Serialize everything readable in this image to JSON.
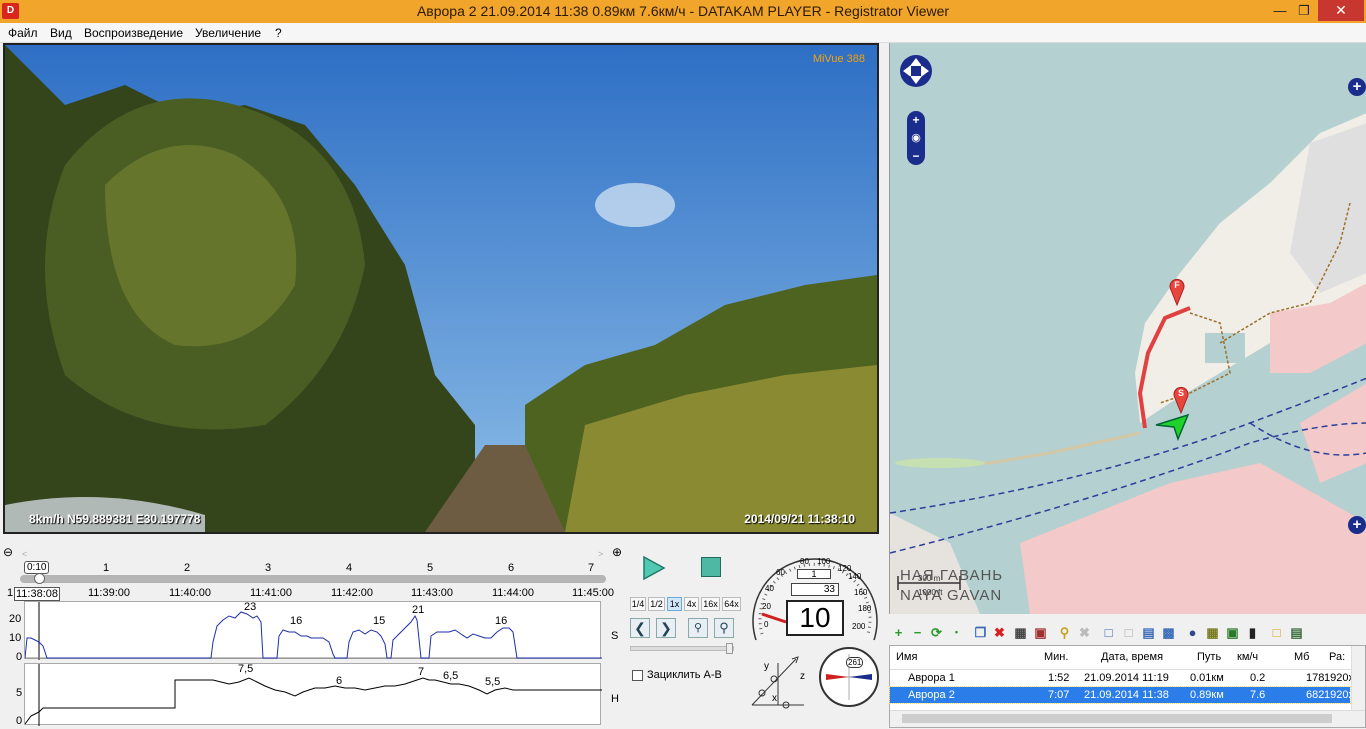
{
  "window": {
    "title": "Аврора 2    21.09.2014 11:38    0.89км    7.6км/ч  -  DATAKAM PLAYER - Registrator Viewer",
    "icon_text": "D"
  },
  "menu": [
    "Файл",
    "Вид",
    "Воспроизведение",
    "Увеличение",
    "?"
  ],
  "video": {
    "osd_left": "8km/h N59.889381 E30.197778",
    "osd_right": "2014/09/21 11:38:10",
    "logo": "MiVue 388"
  },
  "timeline": {
    "zoom_label": "0:10",
    "minute_marks": [
      "1",
      "2",
      "3",
      "4",
      "5",
      "6",
      "7"
    ],
    "current_time": "11:38:08",
    "start_prefix": "1",
    "times": [
      "11:39:00",
      "11:40:00",
      "11:41:00",
      "11:42:00",
      "11:43:00",
      "11:44:00",
      "11:45:00"
    ],
    "graph_s": {
      "label": "S",
      "ticks": [
        "20",
        "10",
        "0"
      ],
      "peaks": [
        "23",
        "16",
        "15",
        "21",
        "16"
      ]
    },
    "graph_h": {
      "label": "H",
      "ticks": [
        "5",
        "0"
      ],
      "peaks": [
        "7,5",
        "6",
        "7",
        "6,5",
        "5,5"
      ]
    }
  },
  "playback": {
    "speeds": [
      "1/4",
      "1/2",
      "1x",
      "4x",
      "16x",
      "64x"
    ],
    "active_speed": "1x",
    "loop_label": "Зациклить А-В"
  },
  "gauge": {
    "speed_value": "10",
    "odometer_top": "1",
    "odometer_bottom": "33",
    "scale": [
      "0",
      "20",
      "40",
      "60",
      "80",
      "100",
      "120",
      "140",
      "160",
      "180",
      "200"
    ],
    "compass_heading": "261",
    "axes": [
      "y",
      "z",
      "x"
    ]
  },
  "map": {
    "label_ru": "НАЯ ГАВАНЬ",
    "label_lat": "NAYA GAVAN",
    "scale_m": "300 m",
    "scale_ft": "1000 ft",
    "marker_finish": "F",
    "marker_start": "S"
  },
  "filelist": {
    "columns": [
      "Имя",
      "Мин.",
      "Дата, время",
      "Путь",
      "км/ч",
      "Мб",
      "Ра:"
    ],
    "rows": [
      {
        "name": "Аврора 1",
        "min": "1:52",
        "datetime": "21.09.2014 11:19",
        "path": "0.01км",
        "speed": "0.2",
        "mb": "178",
        "res": "1920x"
      },
      {
        "name": "Аврора 2",
        "min": "7:07",
        "datetime": "21.09.2014 11:38",
        "path": "0.89км",
        "speed": "7.6",
        "mb": "682",
        "res": "1920x"
      }
    ],
    "selected_index": 1
  },
  "colors": {
    "titlebar": "#f1a52b",
    "track": "#e04040",
    "selection": "#2b7de9"
  }
}
